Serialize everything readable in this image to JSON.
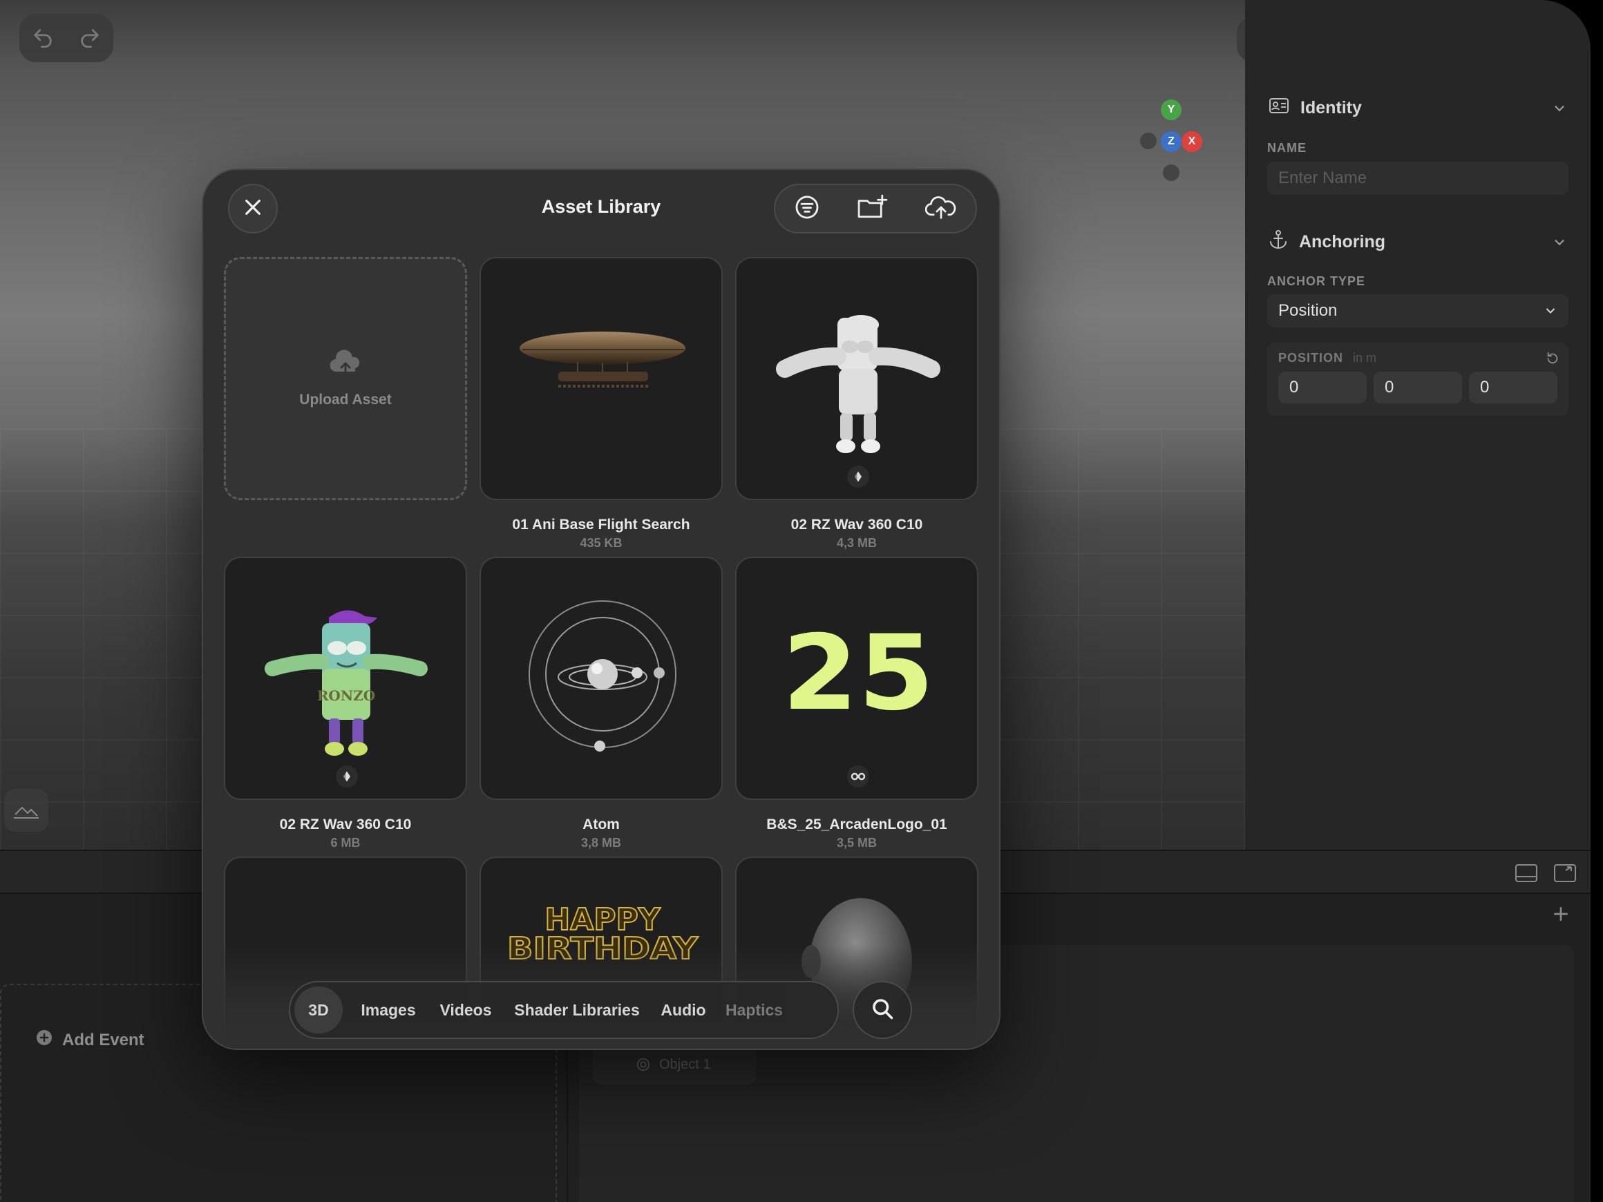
{
  "toolbar": {
    "undo_icon": "undo-icon",
    "redo_icon": "redo-icon",
    "right_icons": [
      "camera-icon",
      "cube-icon",
      "refresh-icon",
      "play-icon",
      "chevron-down-icon",
      "preview-icon",
      "sidebar-toggle-icon"
    ]
  },
  "gizmo": {
    "y": "Y",
    "z": "Z",
    "x": "X"
  },
  "inspector": {
    "identity": {
      "title": "Identity",
      "name_label": "NAME",
      "name_placeholder": "Enter Name"
    },
    "anchoring": {
      "title": "Anchoring",
      "anchor_type_label": "ANCHOR TYPE",
      "anchor_type_value": "Position",
      "position_label": "POSITION",
      "position_unit": "in m",
      "position": [
        "0",
        "0",
        "0"
      ]
    }
  },
  "bottom": {
    "add_event": "Add Event",
    "object_chip": "Object 1"
  },
  "modal": {
    "title": "Asset Library",
    "upload_label": "Upload Asset",
    "assets": [
      {
        "name": "01 Ani Base Flight Search",
        "size": "435 KB",
        "thumb": "airship"
      },
      {
        "name": "02 RZ Wav 360 C10",
        "size": "4,3 MB",
        "thumb": "character-white"
      },
      {
        "name": "02 RZ Wav 360 C10",
        "size": "6 MB",
        "thumb": "character-color"
      },
      {
        "name": "Atom",
        "size": "3,8 MB",
        "thumb": "atom"
      },
      {
        "name": "B&S_25_ArcadenLogo_01",
        "size": "3,5 MB",
        "thumb": "logo-25"
      }
    ],
    "partial_tiles": {
      "birthday_line1": "HAPPY",
      "birthday_line2": "BIRTHDAY",
      "logo_text": "25",
      "character_text": "RONZO"
    },
    "tabs": [
      "3D",
      "Images",
      "Videos",
      "Shader Libraries",
      "Audio",
      "Haptics"
    ],
    "active_tab": "3D"
  },
  "colors": {
    "accent_blue": "#3c74c9",
    "logo_green": "#dff78a",
    "gizmo_x": "#e0413d",
    "gizmo_y": "#48a447",
    "gizmo_z": "#3a71c9"
  }
}
